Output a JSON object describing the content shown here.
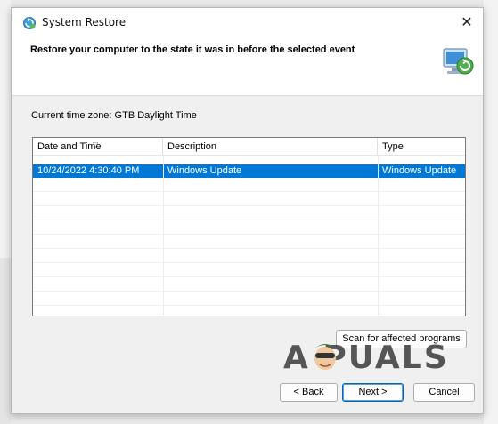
{
  "window": {
    "title": "System Restore",
    "close_glyph": "✕"
  },
  "header": {
    "text": "Restore your computer to the state it was in before the selected event"
  },
  "timezone": {
    "label": "Current time zone: GTB Daylight Time"
  },
  "table": {
    "columns": [
      "Date and Time",
      "Description",
      "Type"
    ],
    "rows": [
      {
        "date": "10/24/2022 4:30:40 PM",
        "description": "Windows Update",
        "type": "Windows Update",
        "selected": true
      }
    ]
  },
  "buttons": {
    "scan": "Scan for affected programs",
    "back": "< Back",
    "next": "Next >",
    "cancel": "Cancel"
  },
  "watermark": {
    "text": "A PUALS"
  },
  "colors": {
    "selection": "#0078d7",
    "accent": "#0067c0"
  }
}
